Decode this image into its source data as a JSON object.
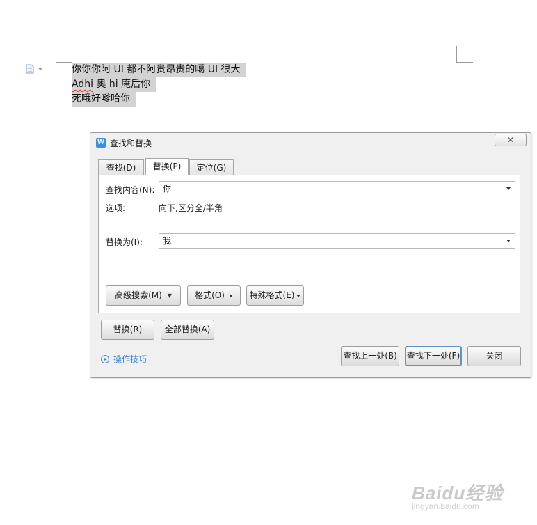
{
  "document": {
    "lines": [
      "你你你阿 UI 都不阿贵昂贵的噶 UI 很大",
      "hi 庵后你",
      "死哦好嗲哈你"
    ],
    "line2_prefix": "Adhi",
    "line2_word": "奥"
  },
  "dialog": {
    "title": "查找和替换",
    "close_glyph": "✕",
    "tabs": [
      {
        "label": "查找(D)",
        "active": false
      },
      {
        "label": "替换(P)",
        "active": true
      },
      {
        "label": "定位(G)",
        "active": false
      }
    ],
    "find": {
      "label": "查找内容(N):",
      "value": "你"
    },
    "options": {
      "label": "选项:",
      "value": "向下,区分全/半角"
    },
    "replace": {
      "label": "替换为(I):",
      "value": "我"
    },
    "buttons": {
      "advanced": "高级搜索(M)",
      "format": "格式(O)",
      "special": "特殊格式(E)",
      "replace": "替换(R)",
      "replace_all": "全部替换(A)",
      "find_prev": "查找上一处(B)",
      "find_next": "查找下一处(F)",
      "close": "关闭"
    },
    "tips": "操作技巧"
  },
  "watermark": {
    "logo": "Baidu经验",
    "url": "jingyan.baidu.com"
  },
  "colors": {
    "accent": "#3a86d4",
    "selection": "#d3d3d3",
    "app_icon": "#3d8fe3"
  }
}
